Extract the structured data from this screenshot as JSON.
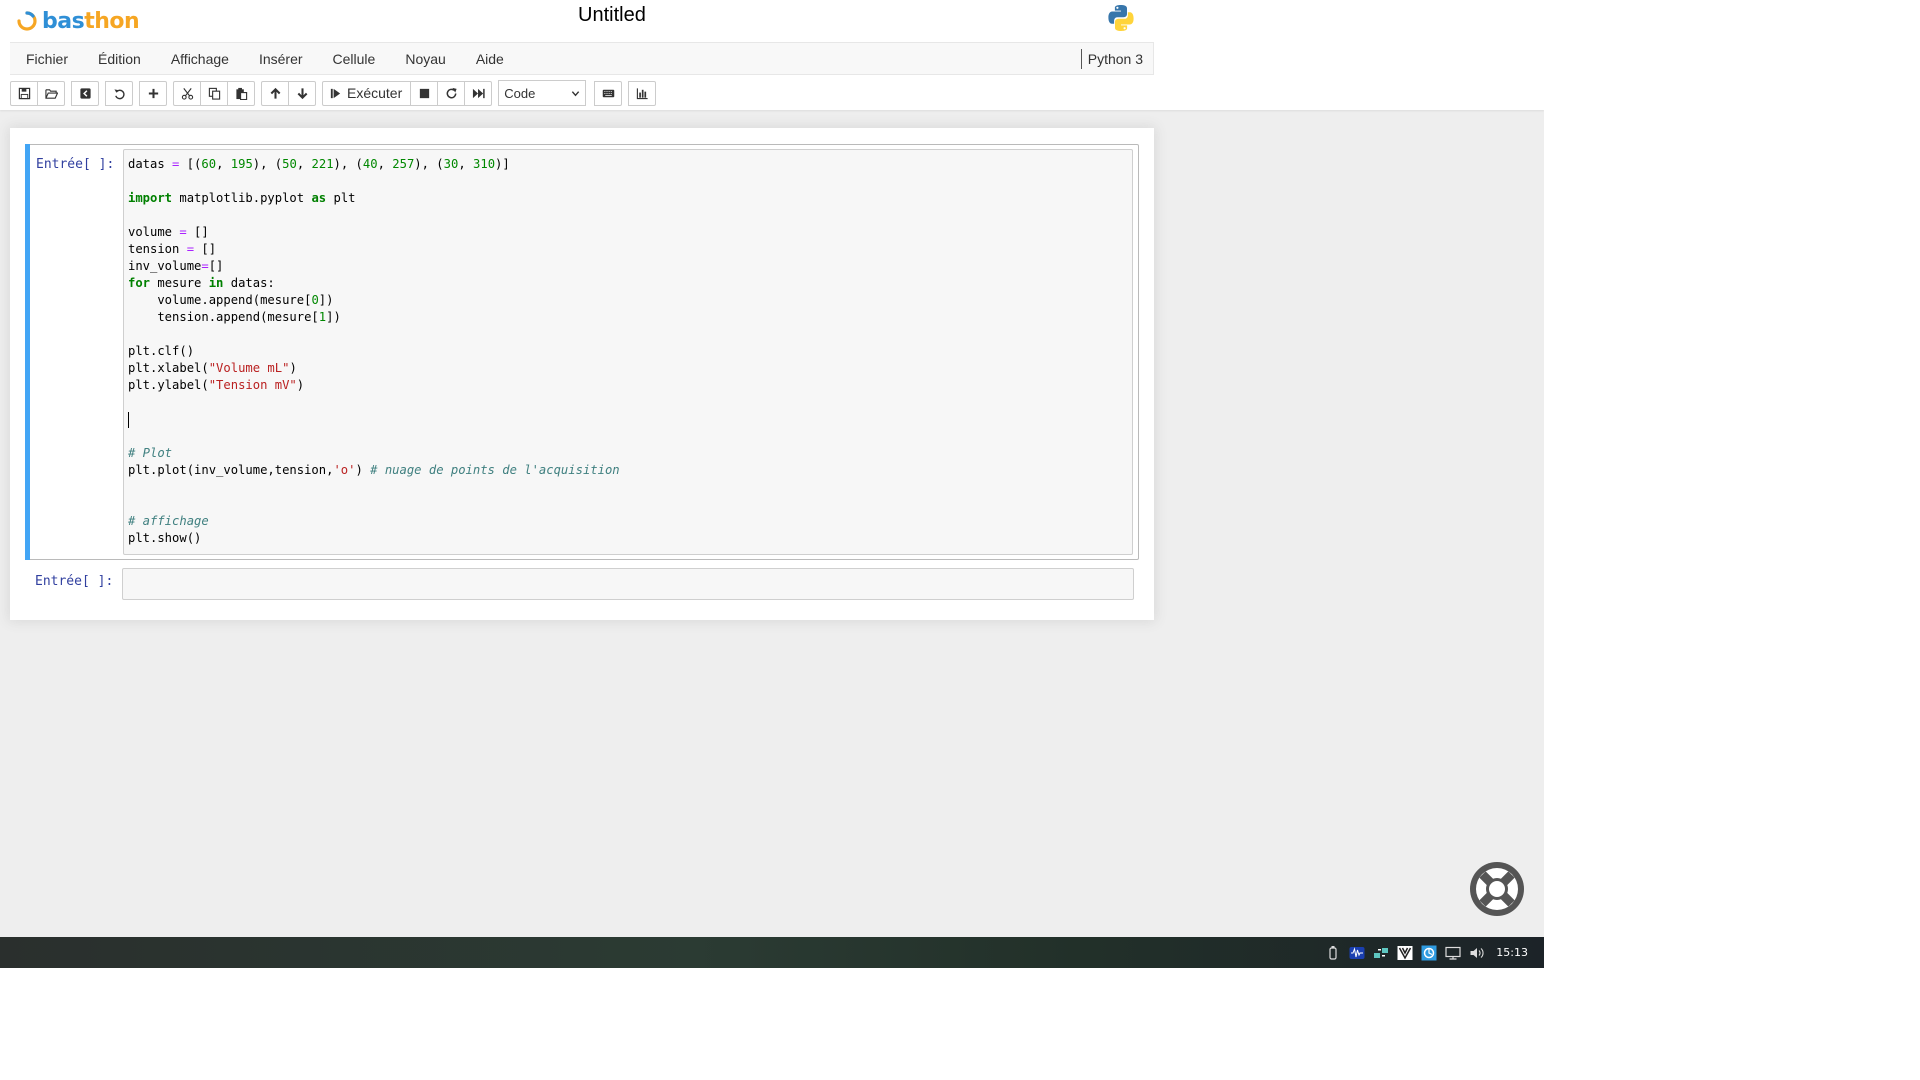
{
  "app": {
    "brand_part1": "bas",
    "brand_part2": "thon",
    "notebook_title": "Untitled",
    "accent_color": "#42a5f5"
  },
  "menubar": {
    "items": [
      "Fichier",
      "Édition",
      "Affichage",
      "Insérer",
      "Cellule",
      "Noyau",
      "Aide"
    ],
    "kernel": "Python 3"
  },
  "toolbar": {
    "buttons": [
      "save-icon",
      "folder-open-icon",
      "save-as-icon",
      "undo-icon",
      "plus-icon",
      "cut-icon",
      "copy-icon",
      "paste-icon",
      "arrow-up-icon",
      "arrow-down-icon",
      "run-icon",
      "stop-icon",
      "restart-icon",
      "fast-forward-icon",
      "keyboard-icon",
      "bar-chart-icon"
    ],
    "run_label": "Exécuter",
    "cell_type_selected": "Code"
  },
  "cells": [
    {
      "prompt": "Entrée[ ]:",
      "code": [
        [
          {
            "t": "datas "
          },
          {
            "t": "=",
            "c": "op"
          },
          {
            "t": " [("
          },
          {
            "t": "60",
            "c": "num"
          },
          {
            "t": ", "
          },
          {
            "t": "195",
            "c": "num"
          },
          {
            "t": "), ("
          },
          {
            "t": "50",
            "c": "num"
          },
          {
            "t": ", "
          },
          {
            "t": "221",
            "c": "num"
          },
          {
            "t": "), ("
          },
          {
            "t": "40",
            "c": "num"
          },
          {
            "t": ", "
          },
          {
            "t": "257",
            "c": "num"
          },
          {
            "t": "), ("
          },
          {
            "t": "30",
            "c": "num"
          },
          {
            "t": ", "
          },
          {
            "t": "310",
            "c": "num"
          },
          {
            "t": ")]"
          }
        ],
        [],
        [
          {
            "t": "import",
            "c": "kw"
          },
          {
            "t": " matplotlib.pyplot "
          },
          {
            "t": "as",
            "c": "kw"
          },
          {
            "t": " plt"
          }
        ],
        [],
        [
          {
            "t": "volume "
          },
          {
            "t": "=",
            "c": "op"
          },
          {
            "t": " []"
          }
        ],
        [
          {
            "t": "tension "
          },
          {
            "t": "=",
            "c": "op"
          },
          {
            "t": " []"
          }
        ],
        [
          {
            "t": "inv_volume"
          },
          {
            "t": "=",
            "c": "op"
          },
          {
            "t": "[]"
          }
        ],
        [
          {
            "t": "for",
            "c": "kw"
          },
          {
            "t": " mesure "
          },
          {
            "t": "in",
            "c": "kw"
          },
          {
            "t": " datas:"
          }
        ],
        [
          {
            "t": "    volume.append(mesure["
          },
          {
            "t": "0",
            "c": "num"
          },
          {
            "t": "])"
          }
        ],
        [
          {
            "t": "    tension.append(mesure["
          },
          {
            "t": "1",
            "c": "num"
          },
          {
            "t": "])"
          }
        ],
        [],
        [
          {
            "t": "plt.clf()"
          }
        ],
        [
          {
            "t": "plt.xlabel("
          },
          {
            "t": "\"Volume mL\"",
            "c": "str"
          },
          {
            "t": ")"
          }
        ],
        [
          {
            "t": "plt.ylabel("
          },
          {
            "t": "\"Tension mV\"",
            "c": "str"
          },
          {
            "t": ")"
          }
        ],
        [],
        [
          {
            "cursor": true
          }
        ],
        [],
        [
          {
            "t": "# Plot",
            "c": "cm"
          }
        ],
        [
          {
            "t": "plt.plot(inv_volume,tension,"
          },
          {
            "t": "'o'",
            "c": "str"
          },
          {
            "t": ") "
          },
          {
            "t": "# nuage de points de l'acquisition",
            "c": "cm"
          }
        ],
        [],
        [],
        [
          {
            "t": "# affichage",
            "c": "cm"
          }
        ],
        [
          {
            "t": "plt.show()"
          }
        ]
      ]
    },
    {
      "prompt": "Entrée[ ]:",
      "code": []
    }
  ],
  "help": {
    "icon": "lifebuoy-icon"
  },
  "taskbar": {
    "tray_icons": [
      "usb-drive-icon",
      "audio-wave-icon",
      "network-manager-icon",
      "vpn-icon",
      "shield-icon",
      "display-icon",
      "volume-icon"
    ],
    "clock": "15:13"
  }
}
